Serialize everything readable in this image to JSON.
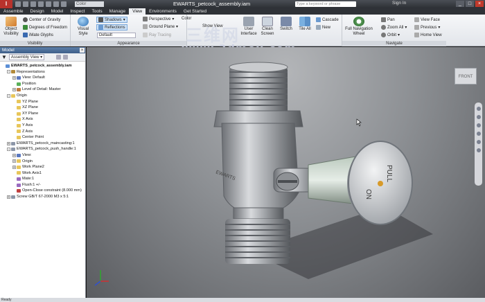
{
  "app": {
    "logo": "I",
    "window_title": "EWARTS_petcock_assembly.iam",
    "sign_in": "Sign In"
  },
  "quick_access": {
    "combo_value": "Color"
  },
  "search": {
    "placeholder": "Type a keyword or phrase"
  },
  "tabs": [
    "Assemble",
    "Design",
    "Model",
    "Inspect",
    "Tools",
    "Manage",
    "View",
    "Environments",
    "Get Started"
  ],
  "active_tab": "View",
  "watermark": {
    "line1": "三维网",
    "line2": "www.3dmox.com"
  },
  "ribbon": {
    "visibility": {
      "title": "Visibility",
      "object_visibility": "Object Visibility",
      "items": [
        "Center of Gravity",
        "Degrees of Freedom",
        "iMate Glyphs"
      ]
    },
    "appearance": {
      "title": "Appearance",
      "visual_style": "Visual Style",
      "shadows": "Shadows",
      "reflections": "Reflections",
      "style_combo": "Default",
      "perspective": "Perspective",
      "ground_plane": "Ground Plane",
      "ray_tracing": "Ray Tracing",
      "color": "Color"
    },
    "windows": {
      "clean_screen": "Clean Screen",
      "user_interface": "User Interface",
      "switch": "Switch",
      "tile_all": "Tile All",
      "cascade": "Cascade",
      "new": "New",
      "show_view": "Show View"
    },
    "navigate": {
      "title": "Navigate",
      "full_nav_wheel": "Full Navigation Wheel",
      "pan": "Pan",
      "zoom_all": "Zoom All",
      "orbit": "Orbit",
      "view_face": "View Face",
      "previous": "Previous",
      "home_view": "Home View"
    }
  },
  "browser": {
    "title": "Model",
    "view_combo": "Assembly View",
    "tree": [
      {
        "label": "EWARTS_petcock_assembly.iam",
        "level": 0,
        "icon": "#5c8fd6",
        "root": true
      },
      {
        "label": "Representations",
        "level": 1,
        "icon": "#b28a3a",
        "exp": "-"
      },
      {
        "label": "View: Default",
        "level": 2,
        "icon": "#5a78c0",
        "exp": "+"
      },
      {
        "label": "Position",
        "level": 2,
        "icon": "#5ab05a"
      },
      {
        "label": "Level of Detail: Master",
        "level": 2,
        "icon": "#c07a3a",
        "exp": "+"
      },
      {
        "label": "Origin",
        "level": 1,
        "icon": "#e8c65a",
        "exp": "-"
      },
      {
        "label": "YZ Plane",
        "level": 2,
        "icon": "#e8c65a"
      },
      {
        "label": "XZ Plane",
        "level": 2,
        "icon": "#e8c65a"
      },
      {
        "label": "XY Plane",
        "level": 2,
        "icon": "#e8c65a"
      },
      {
        "label": "X Axis",
        "level": 2,
        "icon": "#e8c65a"
      },
      {
        "label": "Y Axis",
        "level": 2,
        "icon": "#e8c65a"
      },
      {
        "label": "Z Axis",
        "level": 2,
        "icon": "#e8c65a"
      },
      {
        "label": "Center Point",
        "level": 2,
        "icon": "#e8c65a"
      },
      {
        "label": "EWARTS_petcock_maincasting:1",
        "level": 1,
        "icon": "#8c96a8",
        "exp": "+"
      },
      {
        "label": "EWARTS_petcock_push_handle:1",
        "level": 1,
        "icon": "#8c96a8",
        "exp": "-"
      },
      {
        "label": "View:",
        "level": 2,
        "icon": "#5a78c0",
        "exp": "+"
      },
      {
        "label": "Origin",
        "level": 2,
        "icon": "#e8c65a",
        "exp": "+"
      },
      {
        "label": "Work Plane2",
        "level": 2,
        "icon": "#e8c65a",
        "exp": "+"
      },
      {
        "label": "Work Axis1",
        "level": 2,
        "icon": "#e8c65a"
      },
      {
        "label": "Mate:1",
        "level": 2,
        "icon": "#9a6ac0"
      },
      {
        "label": "Flush:1 +/-",
        "level": 2,
        "icon": "#9a6ac0"
      },
      {
        "label": "Open-Close constraint (8.000 mm)",
        "level": 2,
        "icon": "#c04040"
      },
      {
        "label": "Screw GB/T 67-2000 M3 x 5:1",
        "level": 1,
        "icon": "#8c96a8",
        "exp": "+"
      }
    ]
  },
  "model": {
    "knob_text_pull": "PULL",
    "knob_text_on": "ON",
    "body_text": "EWARTS"
  },
  "viewcube": {
    "label": "FRONT"
  },
  "status": {
    "text": "Ready"
  }
}
